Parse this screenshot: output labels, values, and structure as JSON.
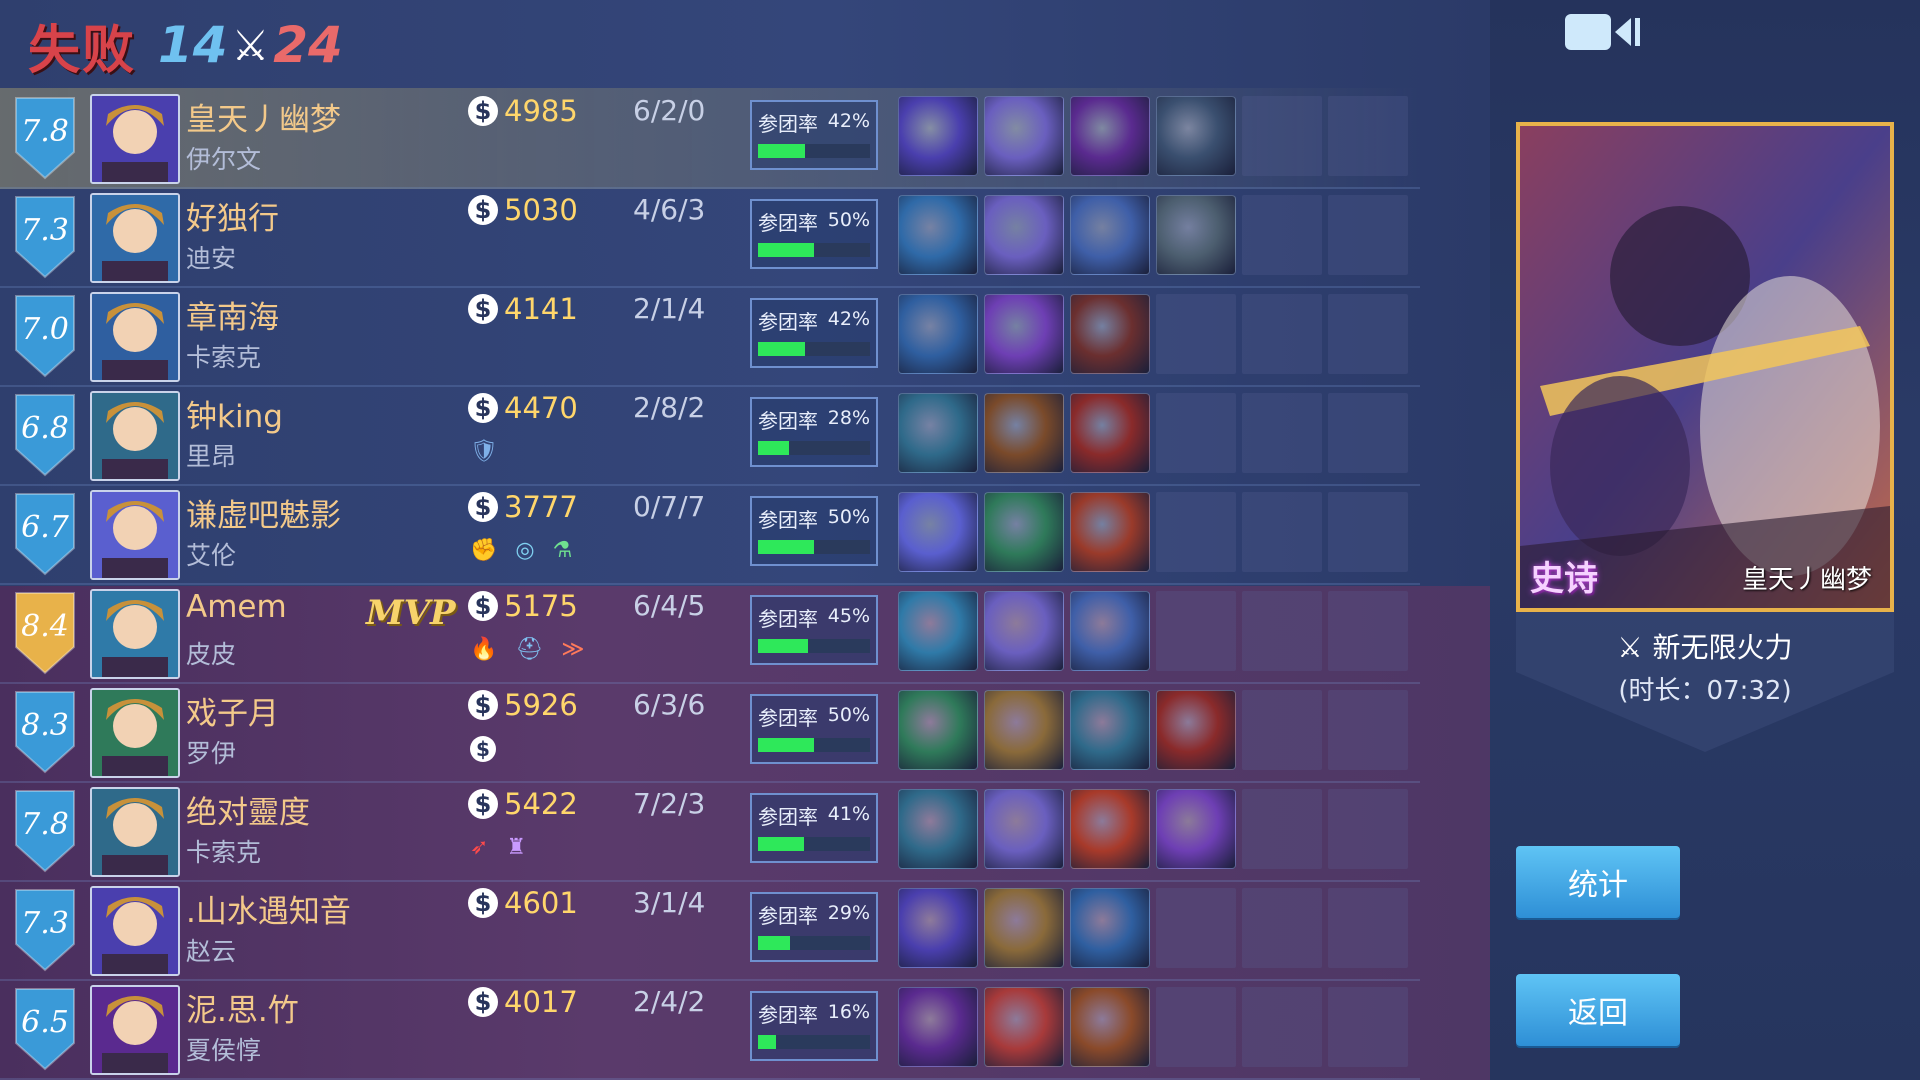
{
  "header": {
    "result": "失败",
    "score_blue": "14",
    "score_red": "24",
    "vs_icon": "crossed-swords-icon"
  },
  "participation_label": "参团率",
  "rows": [
    {
      "rating": "7.8",
      "player": "皇天丿幽梦",
      "hero": "伊尔文",
      "gold": "4985",
      "kda": "6/2/0",
      "pct": "42%",
      "pct_value": 0.42,
      "team": "blue",
      "selected": true,
      "mvp": "",
      "badges": [],
      "items": [
        "#4a3fae",
        "#6a5fbf",
        "#5a2a8f",
        "#3a4f6f"
      ]
    },
    {
      "rating": "7.3",
      "player": "好独行",
      "hero": "迪安",
      "gold": "5030",
      "kda": "4/6/3",
      "pct": "50%",
      "pct_value": 0.5,
      "team": "blue",
      "selected": false,
      "mvp": "",
      "badges": [],
      "items": [
        "#2f6aa8",
        "#6a5fbf",
        "#3f5fa8",
        "#4d5f70"
      ]
    },
    {
      "rating": "7.0",
      "player": "章南海",
      "hero": "卡索克",
      "gold": "4141",
      "kda": "2/1/4",
      "pct": "42%",
      "pct_value": 0.42,
      "team": "blue",
      "selected": false,
      "mvp": "",
      "badges": [],
      "items": [
        "#2f5fa0",
        "#6e3fb4",
        "#6b2f2f"
      ]
    },
    {
      "rating": "6.8",
      "player": "钟king",
      "hero": "里昂",
      "gold": "4470",
      "kda": "2/8/2",
      "pct": "28%",
      "pct_value": 0.28,
      "team": "blue",
      "selected": false,
      "mvp": "",
      "badges": [
        "shield-icon"
      ],
      "items": [
        "#2f6a8a",
        "#7a4a2a",
        "#8a2a2a"
      ]
    },
    {
      "rating": "6.7",
      "player": "谦虚吧魅影",
      "hero": "艾伦",
      "gold": "3777",
      "kda": "0/7/7",
      "pct": "50%",
      "pct_value": 0.5,
      "team": "blue",
      "selected": false,
      "mvp": "",
      "badges": [
        "fist-icon",
        "target-icon",
        "potion-icon"
      ],
      "items": [
        "#5a5fcf",
        "#2f7a5a",
        "#9a3a2a"
      ]
    },
    {
      "rating": "8.4",
      "player": "Amem",
      "hero": "皮皮",
      "gold": "5175",
      "kda": "6/4/5",
      "pct": "45%",
      "pct_value": 0.45,
      "team": "red",
      "selected": false,
      "mvp": "MVP",
      "badges": [
        "fire-icon",
        "helmet-icon",
        "speed-icon"
      ],
      "items": [
        "#2f7aa8",
        "#6a5fbf",
        "#3f5fa8"
      ]
    },
    {
      "rating": "8.3",
      "player": "戏子月",
      "hero": "罗伊",
      "gold": "5926",
      "kda": "6/3/6",
      "pct": "50%",
      "pct_value": 0.5,
      "team": "red",
      "selected": false,
      "mvp": "",
      "badges": [
        "coin-icon"
      ],
      "items": [
        "#2f7a5a",
        "#8a6a3a",
        "#2f6a8a",
        "#8a2a2a"
      ]
    },
    {
      "rating": "7.8",
      "player": "绝对靈度",
      "hero": "卡索克",
      "gold": "5422",
      "kda": "7/2/3",
      "pct": "41%",
      "pct_value": 0.41,
      "team": "red",
      "selected": false,
      "mvp": "",
      "badges": [
        "feather-icon",
        "tower-icon"
      ],
      "items": [
        "#2f6a8a",
        "#6a5fbf",
        "#a83a2a",
        "#6e3fb4"
      ]
    },
    {
      "rating": "7.3",
      "player": ".山水遇知音",
      "hero": "赵云",
      "gold": "4601",
      "kda": "3/1/4",
      "pct": "29%",
      "pct_value": 0.29,
      "team": "red",
      "selected": false,
      "mvp": "",
      "badges": [],
      "items": [
        "#4a3fae",
        "#8a6a3a",
        "#2f5fa0"
      ]
    },
    {
      "rating": "6.5",
      "player": "泥.思.竹",
      "hero": "夏侯惇",
      "gold": "4017",
      "kda": "2/4/2",
      "pct": "16%",
      "pct_value": 0.16,
      "team": "red",
      "selected": false,
      "mvp": "",
      "badges": [],
      "items": [
        "#5a2a8f",
        "#a83a3a",
        "#8a4a2a"
      ]
    }
  ],
  "card": {
    "epic_label": "史诗",
    "name": "皇天丿幽梦"
  },
  "mode": {
    "name": "新无限火力",
    "duration": "(时长：07:32)"
  },
  "buttons": {
    "stats": "统计",
    "back": "返回"
  },
  "colors": {
    "gold": "#ffd66b",
    "mvp_gold": "#f7d36b",
    "bar": "#2ee85a",
    "blue_shield": "#3a9ad8",
    "gold_shield": "#e8b24a",
    "defeat": "#d8434a"
  }
}
